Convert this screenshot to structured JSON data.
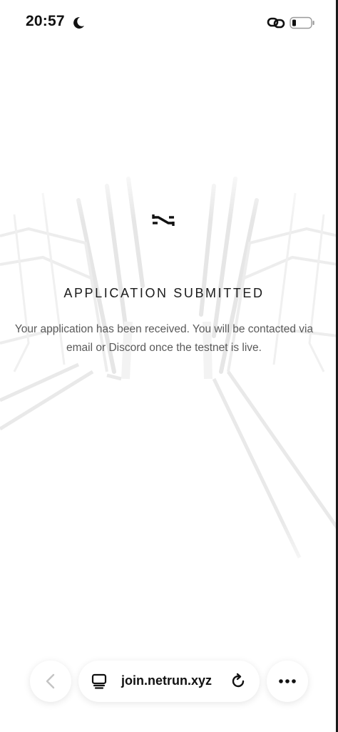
{
  "status_bar": {
    "time": "20:57",
    "icons": [
      "moon-icon",
      "link-icon",
      "battery-icon"
    ]
  },
  "main": {
    "logo": "netrun-logo-icon",
    "title": "APPLICATION SUBMITTED",
    "message": "Your application has been received. You will be contacted via email or Discord once the testnet is live."
  },
  "browser_bar": {
    "url": "join.netrun.xyz",
    "icons": [
      "back-arrow-icon",
      "tabs-icon",
      "reload-icon",
      "more-dots-icon"
    ]
  },
  "colors": {
    "background": "#ffffff",
    "text_primary": "#1b1b1b",
    "text_secondary": "#5a5a5a"
  }
}
